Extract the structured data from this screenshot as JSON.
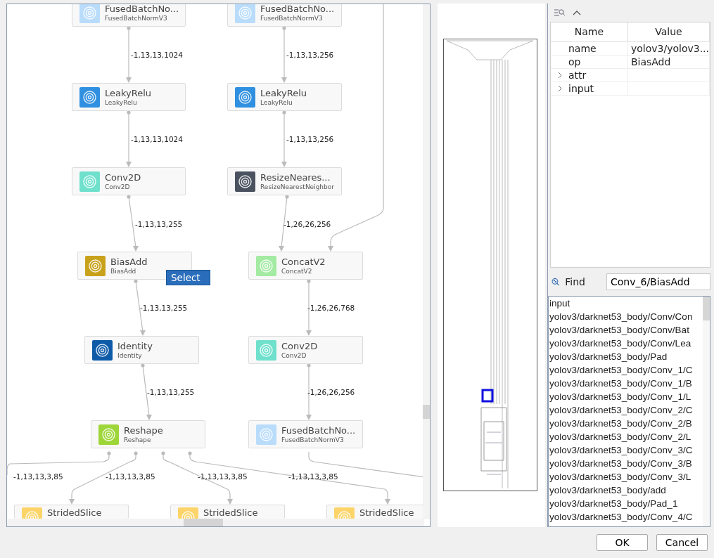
{
  "graph": {
    "nodes": [
      {
        "title": "FusedBatchNo...",
        "subtitle": "FusedBatchNormV3",
        "color": "#b9dcfb"
      },
      {
        "title": "FusedBatchNo...",
        "subtitle": "FusedBatchNormV3",
        "color": "#b9dcfb"
      },
      {
        "title": "LeakyRelu",
        "subtitle": "LeakyRelu",
        "color": "#2f8fe0"
      },
      {
        "title": "LeakyRelu",
        "subtitle": "LeakyRelu",
        "color": "#2f8fe0"
      },
      {
        "title": "Conv2D",
        "subtitle": "Conv2D",
        "color": "#6ee0cc"
      },
      {
        "title": "ResizeNeares...",
        "subtitle": "ResizeNearestNeighbor",
        "color": "#4a5260"
      },
      {
        "title": "BiasAdd",
        "subtitle": "BiasAdd",
        "color": "#c9a21c"
      },
      {
        "title": "ConcatV2",
        "subtitle": "ConcatV2",
        "color": "#a3eaa3"
      },
      {
        "title": "Identity",
        "subtitle": "Identity",
        "color": "#0d5aa8"
      },
      {
        "title": "Conv2D",
        "subtitle": "Conv2D",
        "color": "#6ee0cc"
      },
      {
        "title": "Reshape",
        "subtitle": "Reshape",
        "color": "#9ed63a"
      },
      {
        "title": "FusedBatchNo...",
        "subtitle": "FusedBatchNormV3",
        "color": "#b9dcfb"
      },
      {
        "title": "StridedSlice",
        "color": "#fcd46a"
      },
      {
        "title": "StridedSlice",
        "color": "#fcd46a"
      },
      {
        "title": "StridedSlice",
        "color": "#fcd46a"
      }
    ],
    "edges": [
      {
        "label": "-1,13,13,1024"
      },
      {
        "label": "-1,13,13,256"
      },
      {
        "label": "-1,13,13,1024"
      },
      {
        "label": "-1,13,13,256"
      },
      {
        "label": "-1,13,13,255"
      },
      {
        "label": "-1,26,26,256"
      },
      {
        "label": "-1,13,13,255"
      },
      {
        "label": "-1,26,26,768"
      },
      {
        "label": "-1,13,13,255"
      },
      {
        "label": "-1,26,26,256"
      },
      {
        "label": "-1,13,13,3,85"
      },
      {
        "label": "-1,13,13,3,85"
      },
      {
        "label": "-1,13,13,3,85"
      },
      {
        "label": "-1,13,13,3,85"
      }
    ],
    "context_menu": {
      "item": "Select"
    }
  },
  "properties": {
    "columns": [
      "Name",
      "Value"
    ],
    "rows": [
      {
        "name": "name",
        "value": "yolov3/yolov3...",
        "kind": "field"
      },
      {
        "name": "op",
        "value": "BiasAdd",
        "kind": "field"
      },
      {
        "name": "attr",
        "kind": "group"
      },
      {
        "name": "input",
        "kind": "group"
      }
    ]
  },
  "find": {
    "label": "Find",
    "value": "Conv_6/BiasAdd"
  },
  "results": [
    "input",
    "yolov3/darknet53_body/Conv/Con",
    "yolov3/darknet53_body/Conv/Bat",
    "yolov3/darknet53_body/Conv/Lea",
    "yolov3/darknet53_body/Pad",
    "yolov3/darknet53_body/Conv_1/C",
    "yolov3/darknet53_body/Conv_1/B",
    "yolov3/darknet53_body/Conv_1/L",
    "yolov3/darknet53_body/Conv_2/C",
    "yolov3/darknet53_body/Conv_2/B",
    "yolov3/darknet53_body/Conv_2/L",
    "yolov3/darknet53_body/Conv_3/C",
    "yolov3/darknet53_body/Conv_3/B",
    "yolov3/darknet53_body/Conv_3/L",
    "yolov3/darknet53_body/add",
    "yolov3/darknet53_body/Pad_1",
    "yolov3/darknet53_body/Conv_4/C"
  ],
  "buttons": [
    "OK",
    "Cancel"
  ]
}
